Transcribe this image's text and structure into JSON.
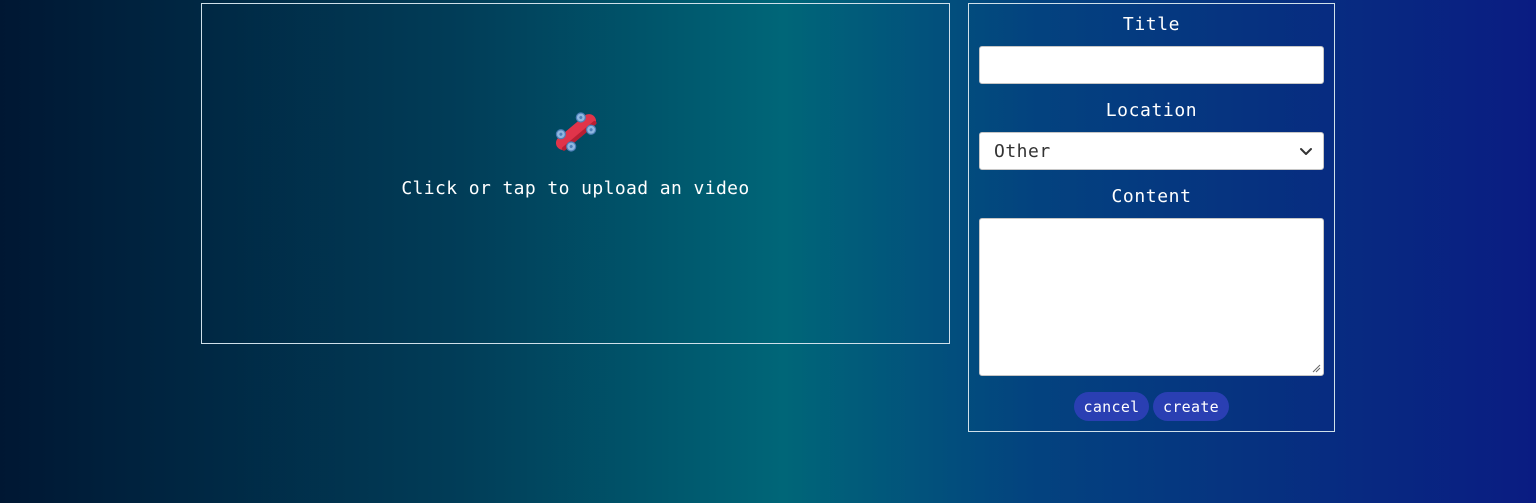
{
  "upload": {
    "icon": "skateboard-icon",
    "prompt": "Click or tap to upload an video"
  },
  "form": {
    "title_label": "Title",
    "title_value": "",
    "location_label": "Location",
    "location_selected": "Other",
    "content_label": "Content",
    "content_value": "",
    "cancel_label": "cancel",
    "create_label": "create"
  },
  "colors": {
    "button_bg": "#2a3fb3",
    "panel_border": "#cfe0ea",
    "skateboard_deck": "#e0344a",
    "skateboard_wheels": "#8fb7e0"
  }
}
